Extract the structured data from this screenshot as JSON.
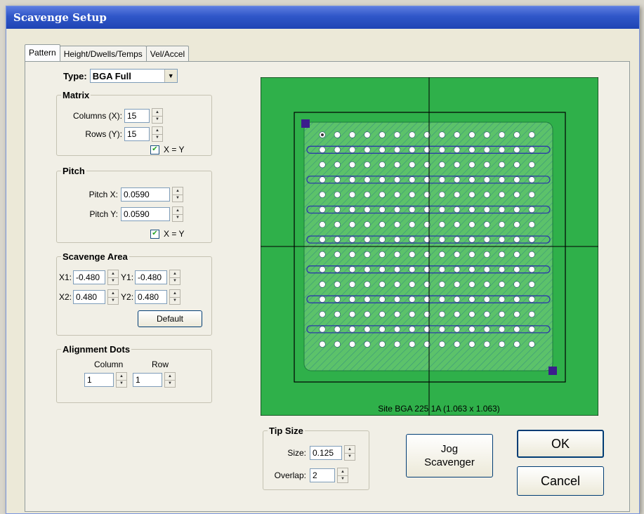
{
  "window": {
    "title": "Scavenge Setup"
  },
  "tabs": [
    {
      "label": "Pattern",
      "active": true
    },
    {
      "label": "Height/Dwells/Temps",
      "active": false
    },
    {
      "label": "Vel/Accel",
      "active": false
    }
  ],
  "type": {
    "label": "Type:",
    "value": "BGA Full"
  },
  "matrix": {
    "title": "Matrix",
    "columns_label": "Columns (X):",
    "columns_value": "15",
    "rows_label": "Rows (Y):",
    "rows_value": "15",
    "xy_label": "X = Y",
    "xy_checked": true
  },
  "pitch": {
    "title": "Pitch",
    "x_label": "Pitch X:",
    "x_value": "0.0590",
    "y_label": "Pitch Y:",
    "y_value": "0.0590",
    "xy_label": "X = Y",
    "xy_checked": true
  },
  "scavenge_area": {
    "title": "Scavenge Area",
    "x1_label": "X1:",
    "x1_value": "-0.480",
    "y1_label": "Y1:",
    "y1_value": "-0.480",
    "x2_label": "X2:",
    "x2_value": "0.480",
    "y2_label": "Y2:",
    "y2_value": "0.480",
    "default_button": "Default"
  },
  "alignment_dots": {
    "title": "Alignment Dots",
    "column_label": "Column",
    "column_value": "1",
    "row_label": "Row",
    "row_value": "1"
  },
  "tip_size": {
    "title": "Tip Size",
    "size_label": "Size:",
    "size_value": "0.125",
    "overlap_label": "Overlap:",
    "overlap_value": "2"
  },
  "preview": {
    "caption": "Site BGA 225 1A (1.063 x 1.063)",
    "rows": 15,
    "cols": 15,
    "colors": {
      "background": "#2fb04a",
      "hatch": "#1d6f8a",
      "path": "#2c3aa8",
      "marker": "#3b1e8c"
    }
  },
  "buttons": {
    "jog": "Jog Scavenger",
    "ok": "OK",
    "cancel": "Cancel"
  },
  "icons": {
    "spin_up": "▲",
    "spin_down": "▼",
    "combo_arrow": "▼",
    "check": "✔"
  }
}
